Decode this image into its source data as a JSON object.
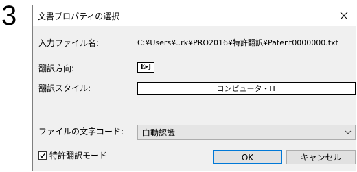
{
  "step_number": "3",
  "dialog": {
    "title": "文書プロパティの選択",
    "close_glyph": "×"
  },
  "fields": {
    "input_file_label": "入力ファイル名:",
    "input_file_value": "C:¥Users¥..rk¥PRO2016¥特許翻訳¥Patent0000000.txt",
    "direction_label": "翻訳方向:",
    "direction_value": "E▸J",
    "style_label": "翻訳スタイル:",
    "style_value": "コンピュータ・IT",
    "encoding_label": "ファイルの文字コード:",
    "encoding_value": "自動認識"
  },
  "checkbox": {
    "label": "特許翻訳モード",
    "checked": true
  },
  "buttons": {
    "ok": "OK",
    "cancel": "キャンセル"
  }
}
